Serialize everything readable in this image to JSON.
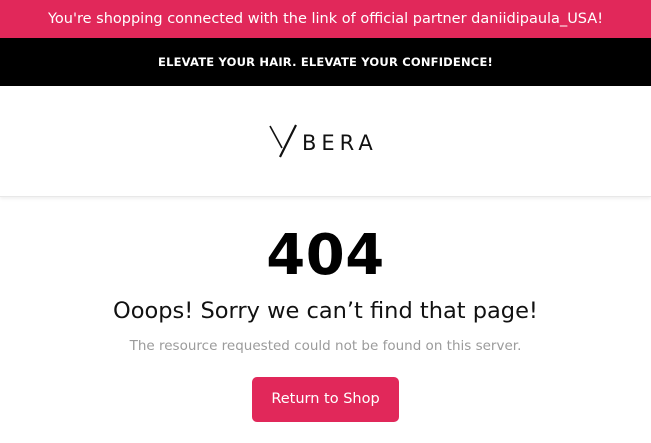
{
  "partner_banner": {
    "text": "You're shopping connected with the link of official partner daniidipaula_USA!",
    "background": "#e1285a"
  },
  "promo_banner": {
    "text": "ELEVATE YOUR HAIR. ELEVATE YOUR CONFIDENCE!",
    "background": "#000000"
  },
  "header": {
    "logo_text": "YBERA"
  },
  "error": {
    "code": "404",
    "title": "Ooops! Sorry we can’t find that page!",
    "description": "The resource requested could not be found on this server.",
    "button_label": "Return to Shop"
  }
}
